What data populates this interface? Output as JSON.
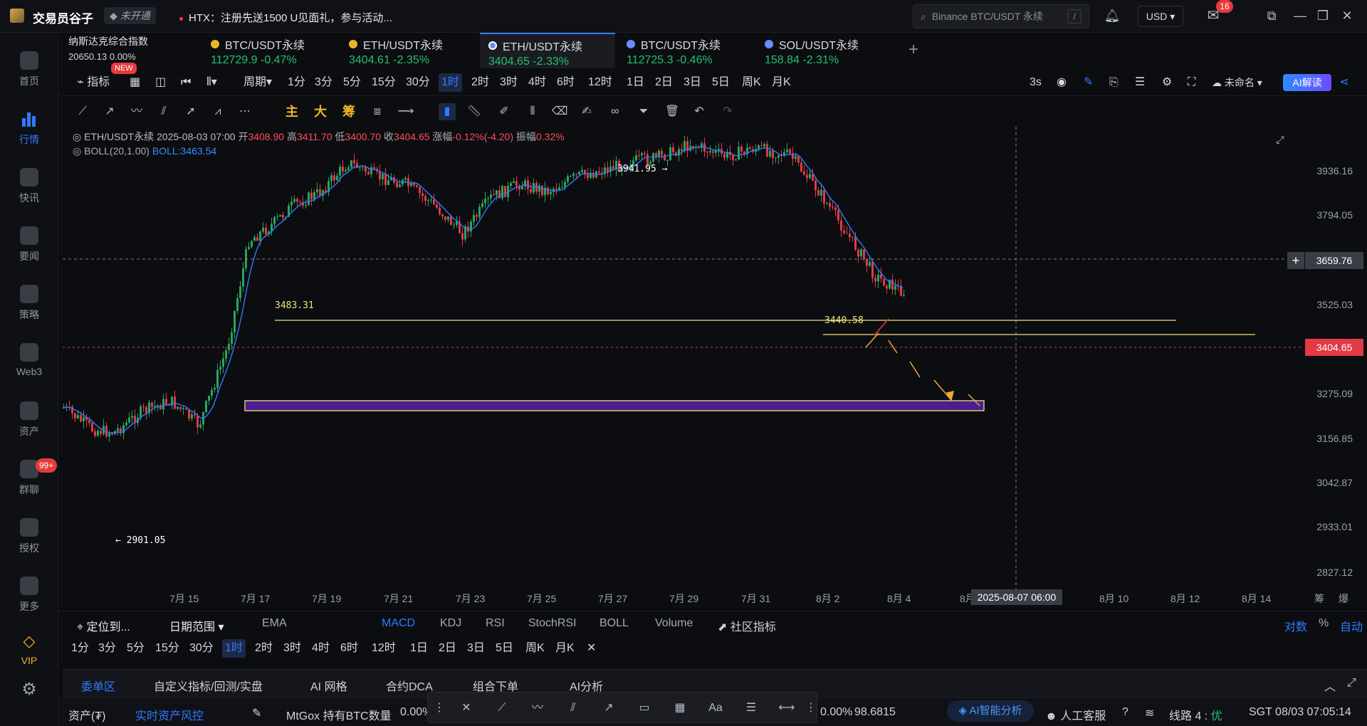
{
  "app": {
    "name": "交易员谷子",
    "vip_status": "未开通",
    "notice": "HTX：注册先送1500 U见面礼，参与活动..."
  },
  "search": {
    "placeholder": "Binance BTC/USDT 永续",
    "shortcut": "/"
  },
  "header": {
    "currency": "USD",
    "mail_count": "16"
  },
  "sidebar": {
    "items": [
      {
        "label": "首页",
        "icon": "home-icon"
      },
      {
        "label": "行情",
        "icon": "market-icon",
        "active": true
      },
      {
        "label": "快讯",
        "icon": "flash-news-icon"
      },
      {
        "label": "要闻",
        "icon": "news-icon"
      },
      {
        "label": "策略",
        "icon": "strategy-icon"
      },
      {
        "label": "Web3",
        "icon": "web3-icon"
      },
      {
        "label": "资产",
        "icon": "wallet-icon"
      },
      {
        "label": "群聊",
        "icon": "chat-icon"
      },
      {
        "label": "授权",
        "icon": "key-icon"
      },
      {
        "label": "更多",
        "icon": "more-icon"
      },
      {
        "label": "VIP",
        "icon": "diamond-icon"
      }
    ],
    "chat_badge": "99+"
  },
  "index": {
    "name": "纳斯达克综合指数",
    "value": "20650.13",
    "change": "0.00%",
    "badge": "NEW"
  },
  "tabs": [
    {
      "name": "BTC/USDT永续",
      "price": "112729.9",
      "change": "-0.47%",
      "coin_color": "#f0b429"
    },
    {
      "name": "ETH/USDT永续",
      "price": "3404.61",
      "change": "-2.35%",
      "coin_color": "#f0b429"
    },
    {
      "name": "ETH/USDT永续",
      "price": "3404.65",
      "change": "-2.33%",
      "coin_color": "#6b8bff",
      "active": true
    },
    {
      "name": "BTC/USDT永续",
      "price": "112725.3",
      "change": "-0.46%",
      "coin_color": "#6b8bff"
    },
    {
      "name": "SOL/USDT永续",
      "price": "158.84",
      "change": "-2.31%",
      "coin_color": "#6b8bff"
    }
  ],
  "toolbar": {
    "indicator_label": "指标",
    "period_label": "周期",
    "intervals": [
      "1分",
      "3分",
      "5分",
      "15分",
      "30分",
      "1时",
      "2时",
      "3时",
      "4时",
      "6时",
      "12时",
      "1日",
      "2日",
      "3日",
      "5日",
      "周K",
      "月K"
    ],
    "active_interval": "1时",
    "refresh": "3s",
    "layout_name": "未命名",
    "ai_button": "AI解读"
  },
  "draw_tools": {
    "cn_labels": [
      "主",
      "大",
      "筹"
    ]
  },
  "chart_info": {
    "symbol": "ETH/USDT永续",
    "datetime": "2025-08-03 07:00",
    "open_label": "开",
    "open": "3408.90",
    "high_label": "高",
    "high": "3411.70",
    "low_label": "低",
    "low": "3400.70",
    "close_label": "收",
    "close": "3404.65",
    "change_label": "涨幅",
    "change": "-0.12%(-4.20)",
    "amp_label": "振幅",
    "amp": "0.32%",
    "boll_name": "BOLL(20,1.00)",
    "boll_value": "BOLL:3463.54"
  },
  "chart_data": {
    "type": "candlestick",
    "y_ticks": [
      "3936.16",
      "3794.05",
      "3659.76",
      "3525.03",
      "3404.65",
      "3275.09",
      "3156.85",
      "3042.87",
      "2933.01",
      "2827.12"
    ],
    "x_ticks": [
      "7月 15",
      "7月 17",
      "7月 19",
      "7月 21",
      "7月 23",
      "7月 25",
      "7月 27",
      "7月 29",
      "7月 31",
      "8月 2",
      "8月 4",
      "8月",
      "8月 10",
      "8月 12",
      "8月 14"
    ],
    "annotations": {
      "high_mark": "3941.95 →",
      "low_mark": "← 2901.05",
      "level1": "3483.31",
      "level2": "3440.58"
    },
    "current_price": "3404.65",
    "crosshair_price": "3659.76",
    "crosshair_date": "2025-08-07 06:00",
    "colors": {
      "up": "#26a65b",
      "down": "#e23945",
      "boll": "#2f7bff",
      "hline": "#f2e27a",
      "zone": "#4b1e8f"
    }
  },
  "indicator_bar": {
    "locate": "定位到...",
    "date_range": "日期范围",
    "main": [
      "EMA"
    ],
    "sub": [
      "MACD",
      "KDJ",
      "RSI",
      "StochRSI",
      "BOLL",
      "Volume"
    ],
    "active_sub": "MACD",
    "community": "社区指标",
    "right": [
      "对数",
      "%",
      "自动"
    ],
    "side_right": [
      "筹",
      "爆"
    ]
  },
  "bottom_tabs": [
    "委单区",
    "自定义指标/回测/实盘",
    "AI 网格",
    "合约DCA",
    "组合下单",
    "AI分析"
  ],
  "status": {
    "assets": "资产(₮)",
    "risk": "实时资产风控",
    "ticker": "MtGox 持有BTC数量",
    "ticker_pct": "0.00%",
    "pct2": "0.00%",
    "value": "98.6815",
    "ai_analyze": "AI智能分析",
    "support": "人工客服",
    "line": "线路 4 :",
    "line_quality": "优",
    "clock": "SGT 08/03 07:05:14"
  }
}
